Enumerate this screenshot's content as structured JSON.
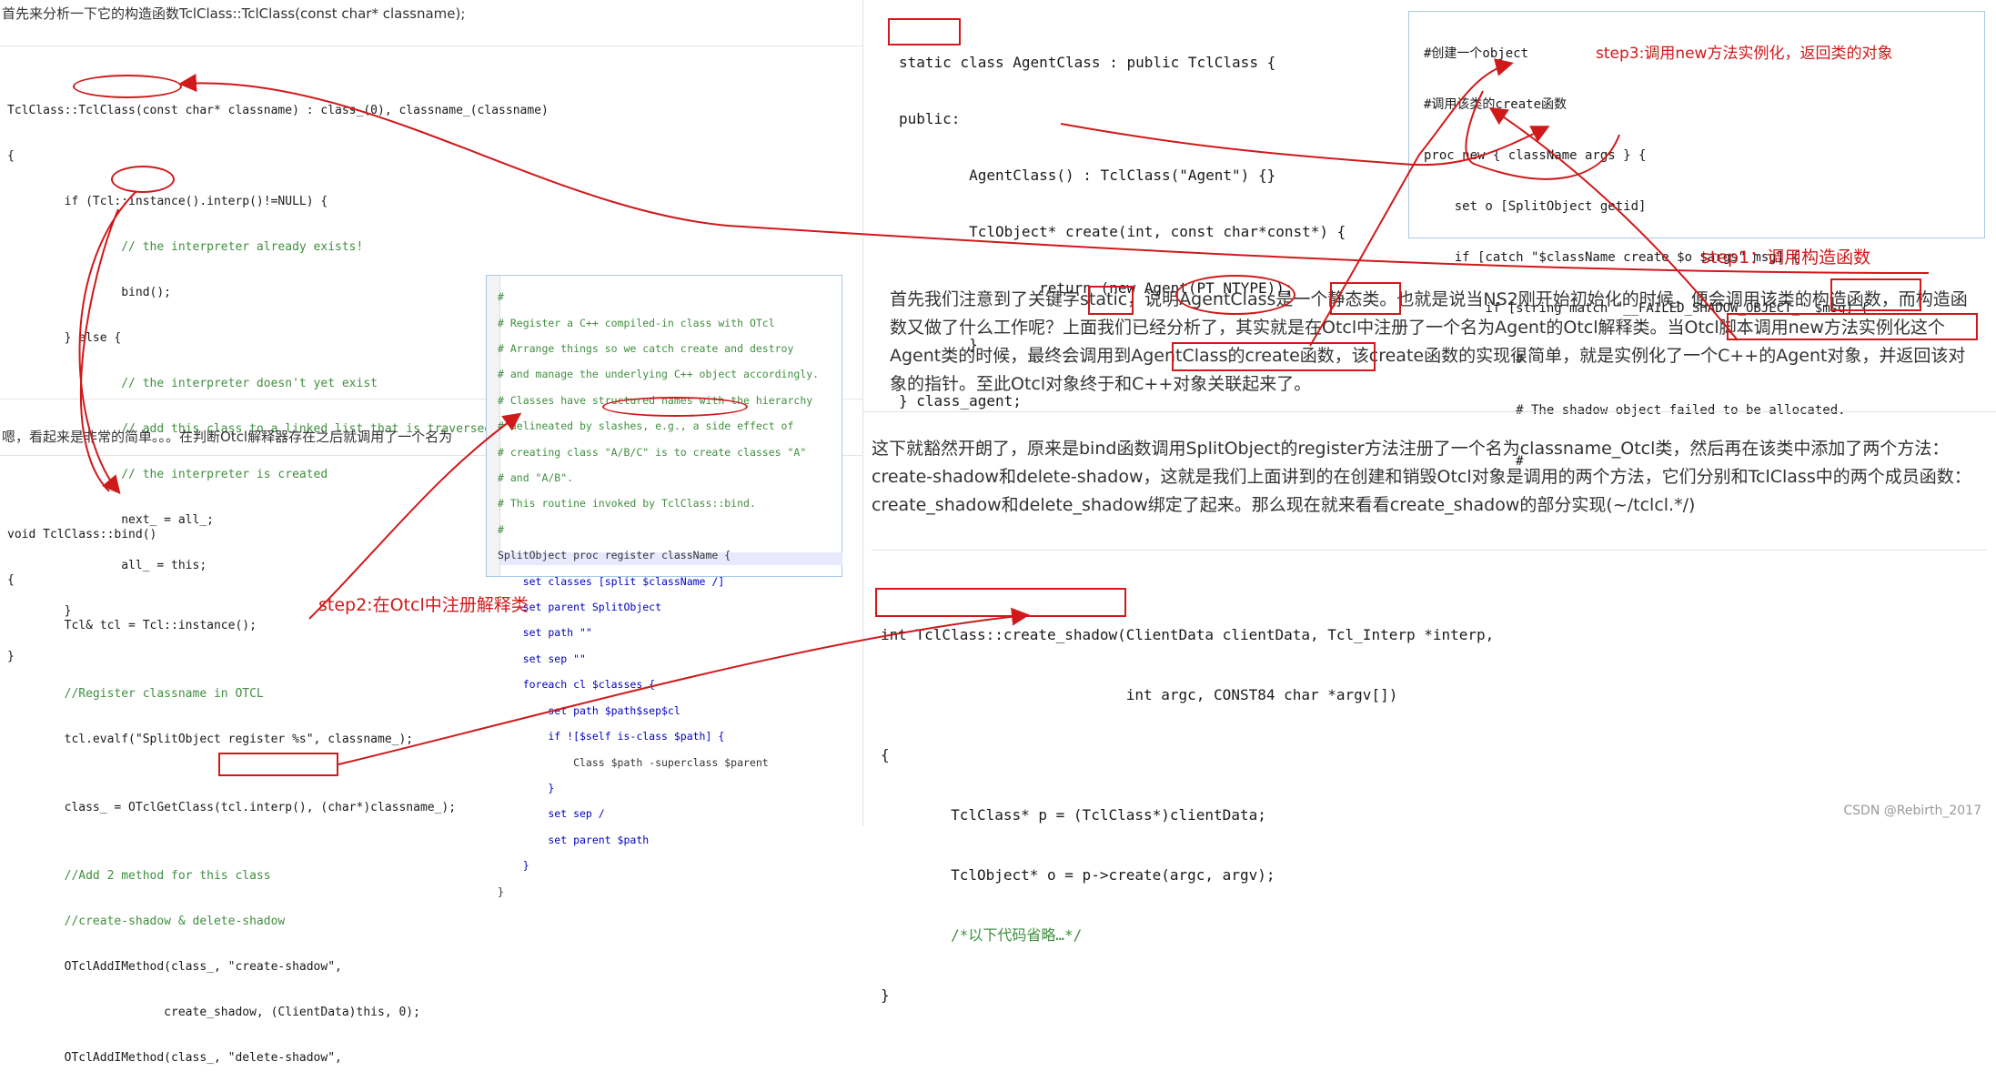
{
  "left": {
    "intro": "首先来分析一下它的构造函数TclClass::TclClass(const char* classname);",
    "ctor_code": [
      "TclClass::TclClass(const char* classname) : class_(0), classname_(classname)",
      "{",
      "        if (Tcl::instance().interp()!=NULL) {",
      "                // the interpreter already exists!",
      "                bind();",
      "        } else {",
      "                // the interpreter doesn't yet exist",
      "                // add this class to a linked list that is traversed when",
      "                // the interpreter is created",
      "                next_ = all_;",
      "                all_ = this;",
      "        }",
      "}"
    ],
    "mid_text": "嗯，看起来是非常的简单。。。在判断Otcl解释器存在之后就调用了一个名为",
    "bind_code": [
      "void TclClass::bind()",
      "{",
      "        Tcl& tcl = Tcl::instance();",
      "",
      "        //Register classname in OTCL",
      "        tcl.evalf(\"SplitObject register %s\", classname_);",
      "",
      "        class_ = OTclGetClass(tcl.interp(), (char*)classname_);",
      "",
      "        //Add 2 method for this class",
      "        //create-shadow & delete-shadow",
      "        OTclAddIMethod(class_, \"create-shadow\",",
      "                      create_shadow, (ClientData)this, 0);",
      "        OTclAddIMethod(class_, \"delete-shadow\","
    ]
  },
  "tcl_popup": {
    "lines": [
      "#",
      "# Register a C++ compiled-in class with OTcl",
      "# Arrange things so we catch create and destroy",
      "# and manage the underlying C++ object accordingly.",
      "# Classes have structured names with the hierarchy",
      "# delineated by slashes, e.g., a side effect of",
      "# creating class \"A/B/C\" is to create classes \"A\"",
      "# and \"A/B\".",
      "# This routine invoked by TclClass::bind.",
      "#",
      "SplitObject proc register className {",
      "    set classes [split $className /]",
      "    set parent SplitObject",
      "    set path \"\"",
      "    set sep \"\"",
      "    foreach cl $classes {",
      "        set path $path$sep$cl",
      "        if ![$self is-class $path] {",
      "            Class $path -superclass $parent",
      "        }",
      "        set sep /",
      "        set parent $path",
      "    }",
      "}"
    ]
  },
  "agent_code": [
    "static class AgentClass : public TclClass {",
    "public:",
    "        AgentClass() : TclClass(\"Agent\") {}",
    "        TclObject* create(int, const char*const*) {",
    "                return (new Agent(PT_NTYPE));",
    "        }",
    "} class_agent;"
  ],
  "tcl_new": {
    "lines": [
      "#创建一个object",
      "#调用该类的create函数",
      "proc new { className args } {",
      "    set o [SplitObject getid]",
      "    if [catch \"$className create $o $args\" msg] {",
      "        if [string match \"__FAILED_SHADOW_OBJECT_\" $msg] {",
      "            #",
      "            # The shadow object failed to be allocated.",
      "            #"
    ]
  },
  "annotations": {
    "step1": "step1：调用构造函数",
    "step2": "step2:在Otcl中注册解释类",
    "step3": "step3:调用new方法实例化，返回类的对象"
  },
  "para1": "首先我们注意到了关键字static，说明AgentClass是一个静态类。也就是说当NS2刚开始初始化的时候，便会调用该类的构造函数，而构造函数又做了什么工作呢？上面我们已经分析了，其实就是在Otcl中注册了一个名为Agent的Otcl解释类。当Otcl脚本调用new方法实例化这个Agent类的时候，最终会调用到AgentClass的create函数，该create函数的实现很简单，就是实例化了一个C++的Agent对象，并返回该对象的指针。至此Otcl对象终于和C++对象关联起来了。",
  "para2": "这下就豁然开朗了，原来是bind函数调用SplitObject的register方法注册了一个名为classname_Otcl类，然后再在该类中添加了两个方法：create-shadow和delete-shadow，这就是我们上面讲到的在创建和销毁Otcl对象是调用的两个方法，它们分别和TclClass中的两个成员函数：create_shadow和delete_shadow绑定了起来。那么现在就来看看create_shadow的部分实现(~/tclcl.*/)",
  "shadow_code": [
    "int TclClass::create_shadow(ClientData clientData, Tcl_Interp *interp,",
    "                            int argc, CONST84 char *argv[])",
    "{",
    "        TclClass* p = (TclClass*)clientData;",
    "        TclObject* o = p->create(argc, argv);",
    "        /*以下代码省略…*/",
    "}"
  ],
  "watermark": "CSDN @Rebirth_2017"
}
